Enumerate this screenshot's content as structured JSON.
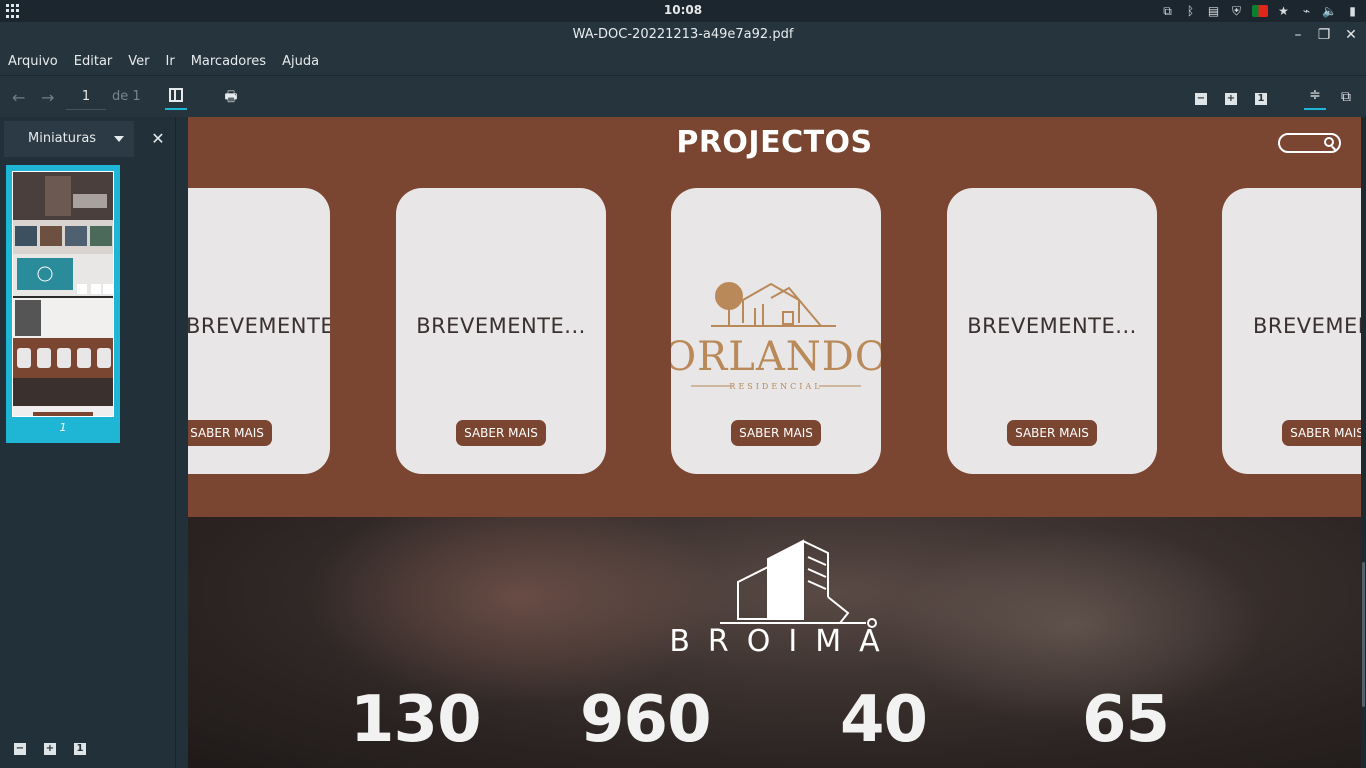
{
  "system": {
    "clock": "10:08"
  },
  "window": {
    "title": "WA-DOC-20221213-a49e7a92.pdf"
  },
  "menu": [
    "Arquivo",
    "Editar",
    "Ver",
    "Ir",
    "Marcadores",
    "Ajuda"
  ],
  "toolbar": {
    "page_value": "1",
    "page_of": "de 1"
  },
  "sidebar": {
    "tab_label": "Miniaturas",
    "thumb_page": "1"
  },
  "document": {
    "section_title": "PROJECTOS",
    "cards": [
      {
        "text": "BREVEMENTE...",
        "button": "SABER MAIS"
      },
      {
        "text": "BREVEMENTE...",
        "button": "SABER MAIS"
      },
      {
        "logo_word": "ORLANDO",
        "logo_sub": "RESIDENCIAL",
        "button": "SABER MAIS"
      },
      {
        "text": "BREVEMENTE...",
        "button": "SABER MAIS"
      },
      {
        "text": "BREVEMENTE...",
        "button": "SABER MAIS"
      }
    ],
    "brand": "BROIMA",
    "stats": [
      "130",
      "960",
      "40",
      "65"
    ]
  },
  "colors": {
    "accent": "#1fb6d6",
    "brown": "#7a4632",
    "card": "#e8e6e6",
    "orlando_gold": "#b9895a"
  }
}
